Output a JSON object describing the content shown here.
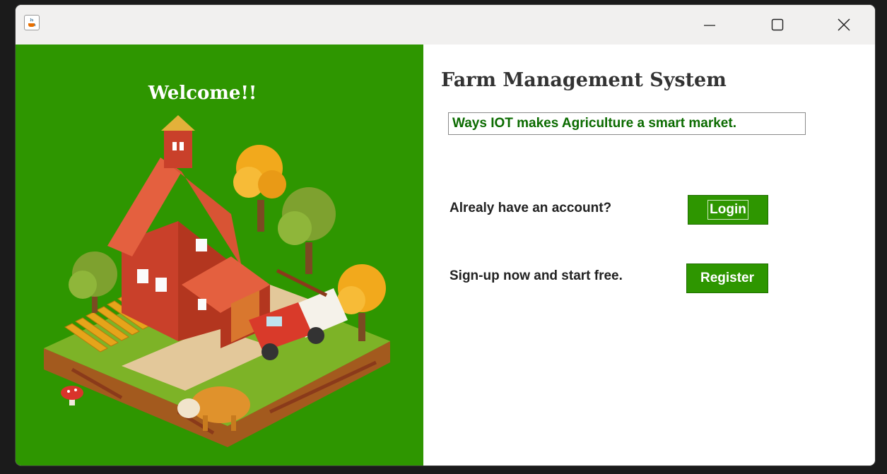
{
  "window": {
    "controls": {
      "minimize": "minimize-icon",
      "maximize": "maximize-icon",
      "close": "close-icon"
    },
    "app_icon": "java-cup-icon"
  },
  "left": {
    "welcome": "Welcome!!",
    "illustration": "farm-illustration"
  },
  "main": {
    "title": "Farm Management System",
    "tagline": "Ways IOT makes Agriculture a smart market.",
    "login_prompt": "Alrealy have an account?",
    "login_button": "Login",
    "signup_prompt": "Sign-up now and start free.",
    "register_button": "Register"
  },
  "colors": {
    "accent_green": "#2e9600",
    "tagline_green": "#0b6b00"
  }
}
